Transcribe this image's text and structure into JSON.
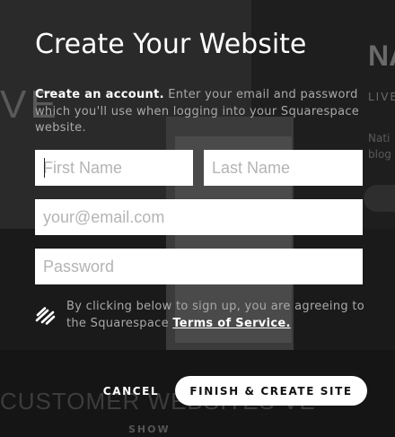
{
  "background": {
    "big_letters": "VE",
    "right_heading": "NA",
    "right_label": "LIVE",
    "right_text_1": "Nati",
    "right_text_2": "blog",
    "customer_text": "CUSTOMER WEBSITES VE",
    "show_text": "SHOW"
  },
  "dialog": {
    "title": "Create Your Website",
    "intro_bold": "Create an account.",
    "intro_text": "Enter your email and password which you'll use when logging into your Squarespace website.",
    "first_name_placeholder": "First Name",
    "last_name_placeholder": "Last Name",
    "email_placeholder": "your@email.com",
    "password_placeholder": "Password",
    "terms_prefix": "By clicking below to sign up, you are agreeing to the Squarespace",
    "terms_link": "Terms of Service.",
    "cancel_label": "CANCEL",
    "finish_label": "FINISH & CREATE SITE",
    "logo_icon": "squarespace-logo-icon"
  }
}
